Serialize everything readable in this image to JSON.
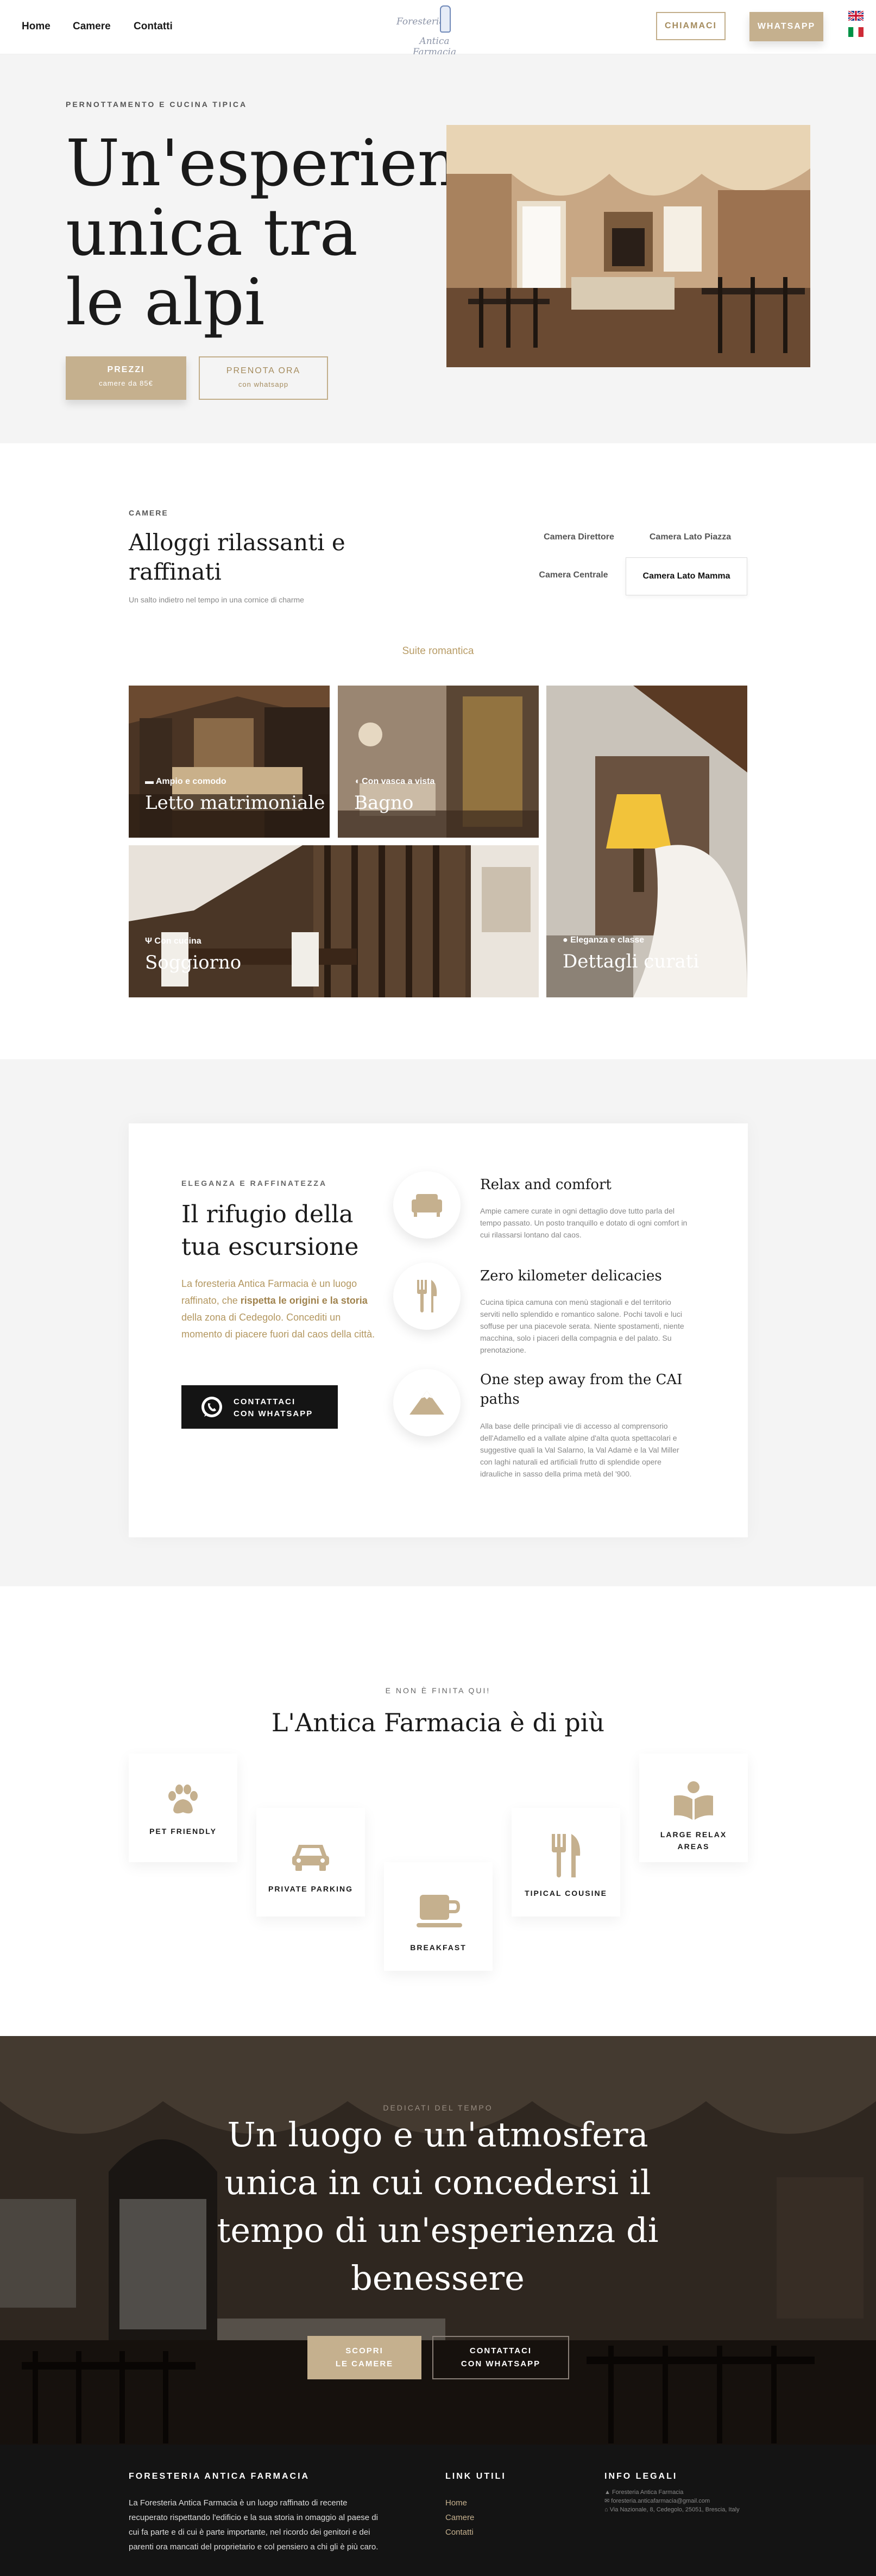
{
  "nav": {
    "links": [
      "Home",
      "Camere",
      "Contatti"
    ],
    "logo_line1": "Foresteria",
    "logo_line2": "Antica Farmacia",
    "call_label": "CHIAMACI",
    "whatsapp_label": "WHATSAPP"
  },
  "hero": {
    "overline": "PERNOTTAMENTO E CUCINA TIPICA",
    "title": "Un'esperienza unica tra le alpi",
    "btn_prices_line1": "PREZZI",
    "btn_prices_line2": "camere da 85€",
    "btn_book_line1": "PRENOTA ORA",
    "btn_book_line2": "con whatsapp"
  },
  "rooms": {
    "overline": "CAMERE",
    "title": "Alloggi rilassanti e raffinati",
    "subtitle": "Un salto indietro nel tempo in una cornice di charme",
    "tabs": [
      "Camera Direttore",
      "Camera Lato Piazza",
      "Camera Centrale",
      "Camera Lato Mamma"
    ],
    "active_tab": "Camera Lato Mamma",
    "suite_label": "Suite romantica",
    "tiles": [
      {
        "small": "Ampio e comodo",
        "big": "Letto matrimoniale"
      },
      {
        "small": "Con vasca a vista",
        "big": "Bagno"
      },
      {
        "small": "Con cucina",
        "big": "Soggiorno"
      },
      {
        "small": "Eleganza e classe",
        "big": "Dettagli curati"
      }
    ]
  },
  "refuge": {
    "overline": "ELEGANZA E RAFFINATEZZA",
    "title": "Il rifugio della tua escursione",
    "text_a": "La foresteria Antica Farmacia è un luogo raffinato, che ",
    "text_b": "rispetta le origini e la storia",
    "text_c": " della zona di Cedegolo. Concediti un momento di piacere fuori dal caos della città.",
    "btn_line1": "CONTATTACI",
    "btn_line2": "CON WHATSAPP",
    "features": [
      {
        "title": "Relax and comfort",
        "text": "Ampie camere curate in ogni dettaglio dove tutto parla del tempo passato. Un posto tranquillo e dotato di ogni comfort in cui rilassarsi lontano dal caos."
      },
      {
        "title": "Zero kilometer delicacies",
        "text": "Cucina tipica camuna con menù stagionali e del territorio serviti nello splendido e romantico salone. Pochi tavoli e luci soffuse per una piacevole serata. Niente spostamenti, niente macchina, solo i piaceri della compagnia e del palato. Su prenotazione."
      },
      {
        "title": "One step away from the CAI paths",
        "text": "Alla base delle principali vie di accesso al comprensorio dell'Adamello ed a vallate alpine d'alta quota spettacolari e suggestive quali la Val Salarno, la Val Adamè e la Val Miller con laghi naturali ed artificiali frutto di splendide opere idrauliche in sasso della prima metà del '900."
      }
    ]
  },
  "amenities": {
    "overline": "E NON È FINITA QUI!",
    "title": "L'Antica Farmacia è di più",
    "items": [
      {
        "label": "PET FRIENDLY",
        "icon": "paw-icon"
      },
      {
        "label": "PRIVATE PARKING",
        "icon": "car-icon"
      },
      {
        "label": "BREAKFAST",
        "icon": "coffee-cup-icon"
      },
      {
        "label": "TIPICAL COUSINE",
        "icon": "cutlery-icon"
      },
      {
        "label": "LARGE RELAX AREAS",
        "icon": "book-reader-icon"
      }
    ]
  },
  "banner": {
    "overline": "DEDICATI DEL TEMPO",
    "title": "Un luogo e un'atmosfera unica in cui concedersi il tempo di un'esperienza di benessere",
    "btn1_line1": "SCOPRI",
    "btn1_line2": "LE CAMERE",
    "btn2_line1": "CONTATTACI",
    "btn2_line2": "CON WHATSAPP"
  },
  "footer": {
    "about_title": "FORESTERIA ANTICA FARMACIA",
    "about_text": "La Foresteria Antica Farmacia è un luogo raffinato di recente recuperato rispettando l'edificio e la sua storia in omaggio al paese di cui fa parte e di cui è parte importante, nel ricordo dei genitori e dei parenti ora mancati del proprietario e col pensiero a chi gli è più caro.",
    "links_title": "LINK UTILI",
    "links": [
      "Home",
      "Camere",
      "Contatti"
    ],
    "legal_title": "INFO LEGALI",
    "legal": [
      "Foresteria Antica Farmacia",
      "foresteria.anticafarmacia@gmail.com",
      "Via Nazionale, 8, Cedegolo, 25051, Brescia, Italy"
    ]
  },
  "colors": {
    "accent": "#c5b08e",
    "accent_dark": "#a58c5e",
    "dark": "#141414",
    "hero_bg": "#f4f4f4"
  }
}
